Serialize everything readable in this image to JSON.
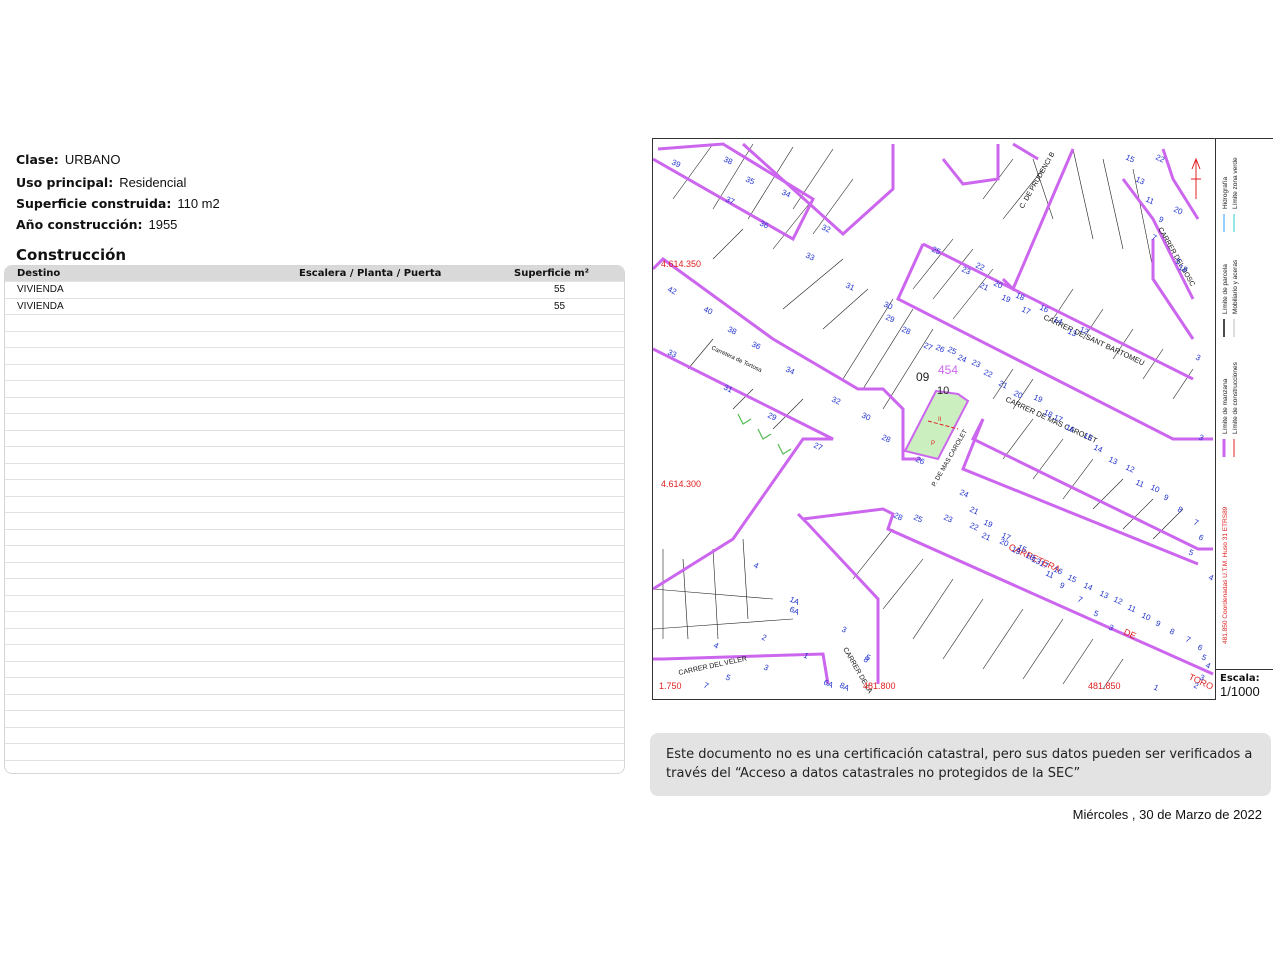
{
  "info": {
    "clase_label": "Clase:",
    "clase_value": "URBANO",
    "uso_label": "Uso principal:",
    "uso_value": "Residencial",
    "superficie_label": "Superficie construida:",
    "superficie_value": "110 m2",
    "anio_label": "Año construcción:",
    "anio_value": "1955"
  },
  "construccion": {
    "title": "Construcción",
    "headers": {
      "destino": "Destino",
      "escalera": "Escalera / Planta / Puerta",
      "superficie": "Superficie m²"
    },
    "rows": [
      {
        "destino": "VIVIENDA",
        "escalera": "",
        "superficie": "55"
      },
      {
        "destino": "VIVIENDA",
        "escalera": "",
        "superficie": "55"
      }
    ],
    "empty_rows": 28
  },
  "map": {
    "streets": {
      "prudenci": "C. DE PRUDENCI B",
      "bosc": "CARRER DEL BOSC",
      "sant_bartomeu": "CARRER DE SANT BARTOMEU",
      "mas_carolet": "CARRER DE MAS CAROLET",
      "p_mas_carolet": "P. DE MAS CAROLET",
      "tortosa": "Carretera de Tortosa",
      "veler": "CARRER DEL VELER",
      "carrer_la": "CARRER DE LA",
      "carretera": "CARRETERA",
      "de": "DE",
      "toro": "TORO"
    },
    "coords": {
      "n1": "4.614.350",
      "n2": "4.614.300",
      "e1": "1.750",
      "e2": "481.800",
      "e3": "481.850"
    },
    "block_id": "09",
    "block_id_2": "454",
    "parcel_num": "10",
    "parcel_letters": [
      "II",
      "P"
    ],
    "house_numbers_left": [
      "39",
      "38",
      "35",
      "37",
      "34",
      "36",
      "32",
      "33",
      "31",
      "42",
      "40",
      "38",
      "36",
      "34",
      "32",
      "30",
      "28",
      "26",
      "33",
      "31",
      "29",
      "27",
      "4",
      "6A",
      "1A",
      "3",
      "5",
      "4",
      "2",
      "3",
      "5",
      "7",
      "1",
      "8",
      "6A",
      "8A"
    ],
    "house_numbers_right": [
      "15",
      "22",
      "13",
      "11",
      "9",
      "7",
      "5",
      "20",
      "18",
      "3",
      "25",
      "23",
      "22",
      "21",
      "20",
      "19",
      "18",
      "17",
      "16",
      "14",
      "13",
      "12",
      "30",
      "29",
      "28",
      "27",
      "26",
      "25",
      "24",
      "23",
      "22",
      "21",
      "20",
      "19",
      "18",
      "17",
      "16",
      "15",
      "14",
      "13",
      "12",
      "11",
      "10",
      "9",
      "8",
      "7",
      "6",
      "5",
      "4",
      "3",
      "21",
      "19",
      "17",
      "15",
      "13",
      "11",
      "9",
      "7",
      "5",
      "3",
      "24",
      "23",
      "22",
      "21",
      "20",
      "19",
      "18",
      "17",
      "16",
      "15",
      "14",
      "13",
      "12",
      "11",
      "10",
      "9",
      "8",
      "7",
      "6",
      "5",
      "4",
      "3",
      "2",
      "1",
      "28",
      "25"
    ],
    "legend": {
      "manzana": "Límite de manzana",
      "parcela": "Límite de parcela",
      "hidrografia": "Hidrografía",
      "construcciones": "Límite de construcciones",
      "mobiliario": "Mobiliario y aceras",
      "zona_verde": "Límite zona verde",
      "coordenadas": "481.850 Coordenadas U.T.M. Huso 31 ETRS89"
    },
    "scale_label": "Escala:",
    "scale_value": "1/1000",
    "colors": {
      "block": "#cc66ee",
      "parcel_fill": "#ccefbf",
      "number": "#2233cc",
      "coord": "#e02020"
    }
  },
  "disclaimer": "Este documento no es una certificación catastral, pero sus datos pueden ser verificados a través del “Acceso a datos catastrales no protegidos de la SEC”",
  "date": "Miércoles , 30 de Marzo de 2022"
}
